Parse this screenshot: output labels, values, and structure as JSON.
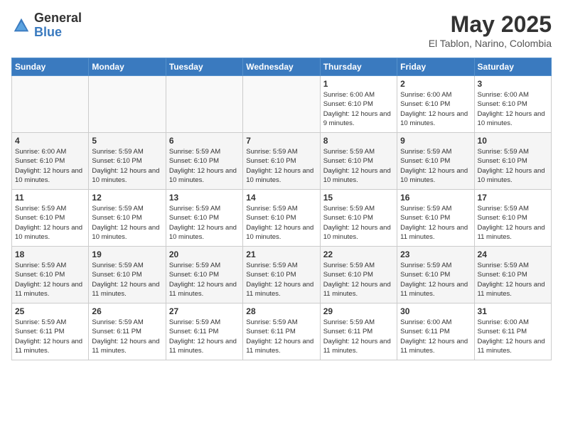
{
  "header": {
    "logo_general": "General",
    "logo_blue": "Blue",
    "title": "May 2025",
    "location": "El Tablon, Narino, Colombia"
  },
  "days_of_week": [
    "Sunday",
    "Monday",
    "Tuesday",
    "Wednesday",
    "Thursday",
    "Friday",
    "Saturday"
  ],
  "weeks": [
    [
      {
        "day": "",
        "info": ""
      },
      {
        "day": "",
        "info": ""
      },
      {
        "day": "",
        "info": ""
      },
      {
        "day": "",
        "info": ""
      },
      {
        "day": "1",
        "info": "Sunrise: 6:00 AM\nSunset: 6:10 PM\nDaylight: 12 hours\nand 9 minutes."
      },
      {
        "day": "2",
        "info": "Sunrise: 6:00 AM\nSunset: 6:10 PM\nDaylight: 12 hours\nand 10 minutes."
      },
      {
        "day": "3",
        "info": "Sunrise: 6:00 AM\nSunset: 6:10 PM\nDaylight: 12 hours\nand 10 minutes."
      }
    ],
    [
      {
        "day": "4",
        "info": "Sunrise: 6:00 AM\nSunset: 6:10 PM\nDaylight: 12 hours\nand 10 minutes."
      },
      {
        "day": "5",
        "info": "Sunrise: 5:59 AM\nSunset: 6:10 PM\nDaylight: 12 hours\nand 10 minutes."
      },
      {
        "day": "6",
        "info": "Sunrise: 5:59 AM\nSunset: 6:10 PM\nDaylight: 12 hours\nand 10 minutes."
      },
      {
        "day": "7",
        "info": "Sunrise: 5:59 AM\nSunset: 6:10 PM\nDaylight: 12 hours\nand 10 minutes."
      },
      {
        "day": "8",
        "info": "Sunrise: 5:59 AM\nSunset: 6:10 PM\nDaylight: 12 hours\nand 10 minutes."
      },
      {
        "day": "9",
        "info": "Sunrise: 5:59 AM\nSunset: 6:10 PM\nDaylight: 12 hours\nand 10 minutes."
      },
      {
        "day": "10",
        "info": "Sunrise: 5:59 AM\nSunset: 6:10 PM\nDaylight: 12 hours\nand 10 minutes."
      }
    ],
    [
      {
        "day": "11",
        "info": "Sunrise: 5:59 AM\nSunset: 6:10 PM\nDaylight: 12 hours\nand 10 minutes."
      },
      {
        "day": "12",
        "info": "Sunrise: 5:59 AM\nSunset: 6:10 PM\nDaylight: 12 hours\nand 10 minutes."
      },
      {
        "day": "13",
        "info": "Sunrise: 5:59 AM\nSunset: 6:10 PM\nDaylight: 12 hours\nand 10 minutes."
      },
      {
        "day": "14",
        "info": "Sunrise: 5:59 AM\nSunset: 6:10 PM\nDaylight: 12 hours\nand 10 minutes."
      },
      {
        "day": "15",
        "info": "Sunrise: 5:59 AM\nSunset: 6:10 PM\nDaylight: 12 hours\nand 10 minutes."
      },
      {
        "day": "16",
        "info": "Sunrise: 5:59 AM\nSunset: 6:10 PM\nDaylight: 12 hours\nand 11 minutes."
      },
      {
        "day": "17",
        "info": "Sunrise: 5:59 AM\nSunset: 6:10 PM\nDaylight: 12 hours\nand 11 minutes."
      }
    ],
    [
      {
        "day": "18",
        "info": "Sunrise: 5:59 AM\nSunset: 6:10 PM\nDaylight: 12 hours\nand 11 minutes."
      },
      {
        "day": "19",
        "info": "Sunrise: 5:59 AM\nSunset: 6:10 PM\nDaylight: 12 hours\nand 11 minutes."
      },
      {
        "day": "20",
        "info": "Sunrise: 5:59 AM\nSunset: 6:10 PM\nDaylight: 12 hours\nand 11 minutes."
      },
      {
        "day": "21",
        "info": "Sunrise: 5:59 AM\nSunset: 6:10 PM\nDaylight: 12 hours\nand 11 minutes."
      },
      {
        "day": "22",
        "info": "Sunrise: 5:59 AM\nSunset: 6:10 PM\nDaylight: 12 hours\nand 11 minutes."
      },
      {
        "day": "23",
        "info": "Sunrise: 5:59 AM\nSunset: 6:10 PM\nDaylight: 12 hours\nand 11 minutes."
      },
      {
        "day": "24",
        "info": "Sunrise: 5:59 AM\nSunset: 6:10 PM\nDaylight: 12 hours\nand 11 minutes."
      }
    ],
    [
      {
        "day": "25",
        "info": "Sunrise: 5:59 AM\nSunset: 6:11 PM\nDaylight: 12 hours\nand 11 minutes."
      },
      {
        "day": "26",
        "info": "Sunrise: 5:59 AM\nSunset: 6:11 PM\nDaylight: 12 hours\nand 11 minutes."
      },
      {
        "day": "27",
        "info": "Sunrise: 5:59 AM\nSunset: 6:11 PM\nDaylight: 12 hours\nand 11 minutes."
      },
      {
        "day": "28",
        "info": "Sunrise: 5:59 AM\nSunset: 6:11 PM\nDaylight: 12 hours\nand 11 minutes."
      },
      {
        "day": "29",
        "info": "Sunrise: 5:59 AM\nSunset: 6:11 PM\nDaylight: 12 hours\nand 11 minutes."
      },
      {
        "day": "30",
        "info": "Sunrise: 6:00 AM\nSunset: 6:11 PM\nDaylight: 12 hours\nand 11 minutes."
      },
      {
        "day": "31",
        "info": "Sunrise: 6:00 AM\nSunset: 6:11 PM\nDaylight: 12 hours\nand 11 minutes."
      }
    ]
  ]
}
